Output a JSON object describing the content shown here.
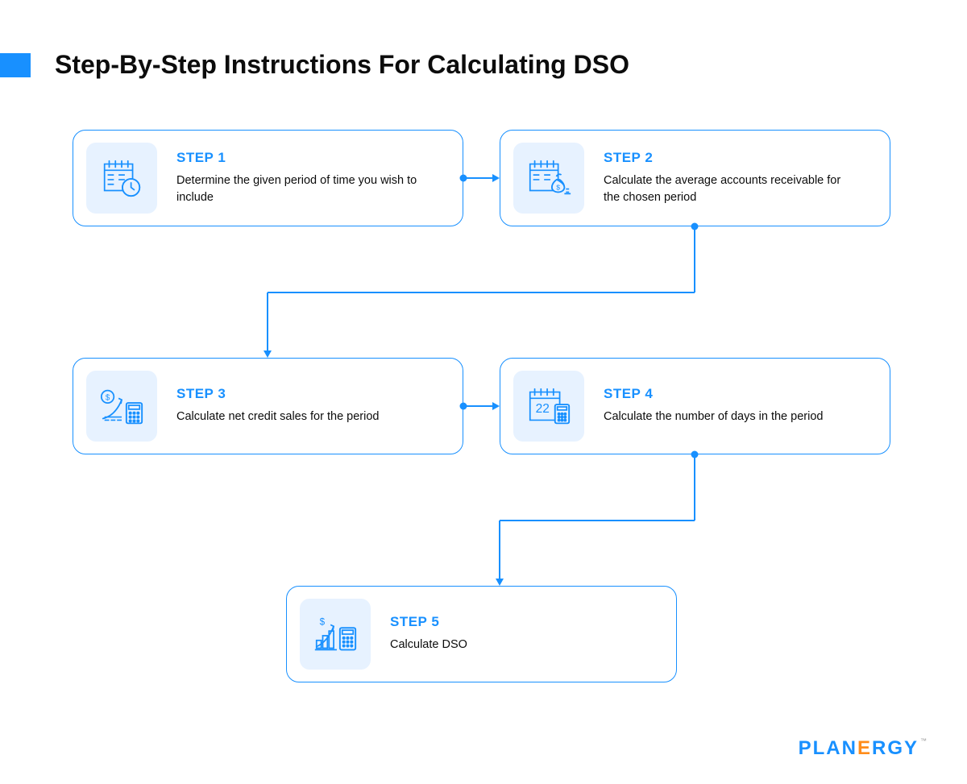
{
  "title": "Step-By-Step Instructions For Calculating DSO",
  "steps": [
    {
      "label": "STEP 1",
      "desc": "Determine the given period of time you wish to include",
      "icon": "calendar-clock-icon"
    },
    {
      "label": "STEP 2",
      "desc": "Calculate the average accounts receivable for the chosen period",
      "icon": "calendar-money-icon"
    },
    {
      "label": "STEP 3",
      "desc": "Calculate net credit sales for the period",
      "icon": "growth-calculator-icon"
    },
    {
      "label": "STEP 4",
      "desc": "Calculate the number of days in the period",
      "icon": "calendar-days-icon"
    },
    {
      "label": "STEP 5",
      "desc": "Calculate DSO",
      "icon": "chart-calculator-icon"
    }
  ],
  "brand": {
    "name": "PLANERGY",
    "accent_char_index": 4
  },
  "colors": {
    "primary": "#1890ff",
    "icon_bg": "#e7f2ff",
    "text": "#0c0c0c",
    "brand_accent": "#ff8c1a"
  }
}
